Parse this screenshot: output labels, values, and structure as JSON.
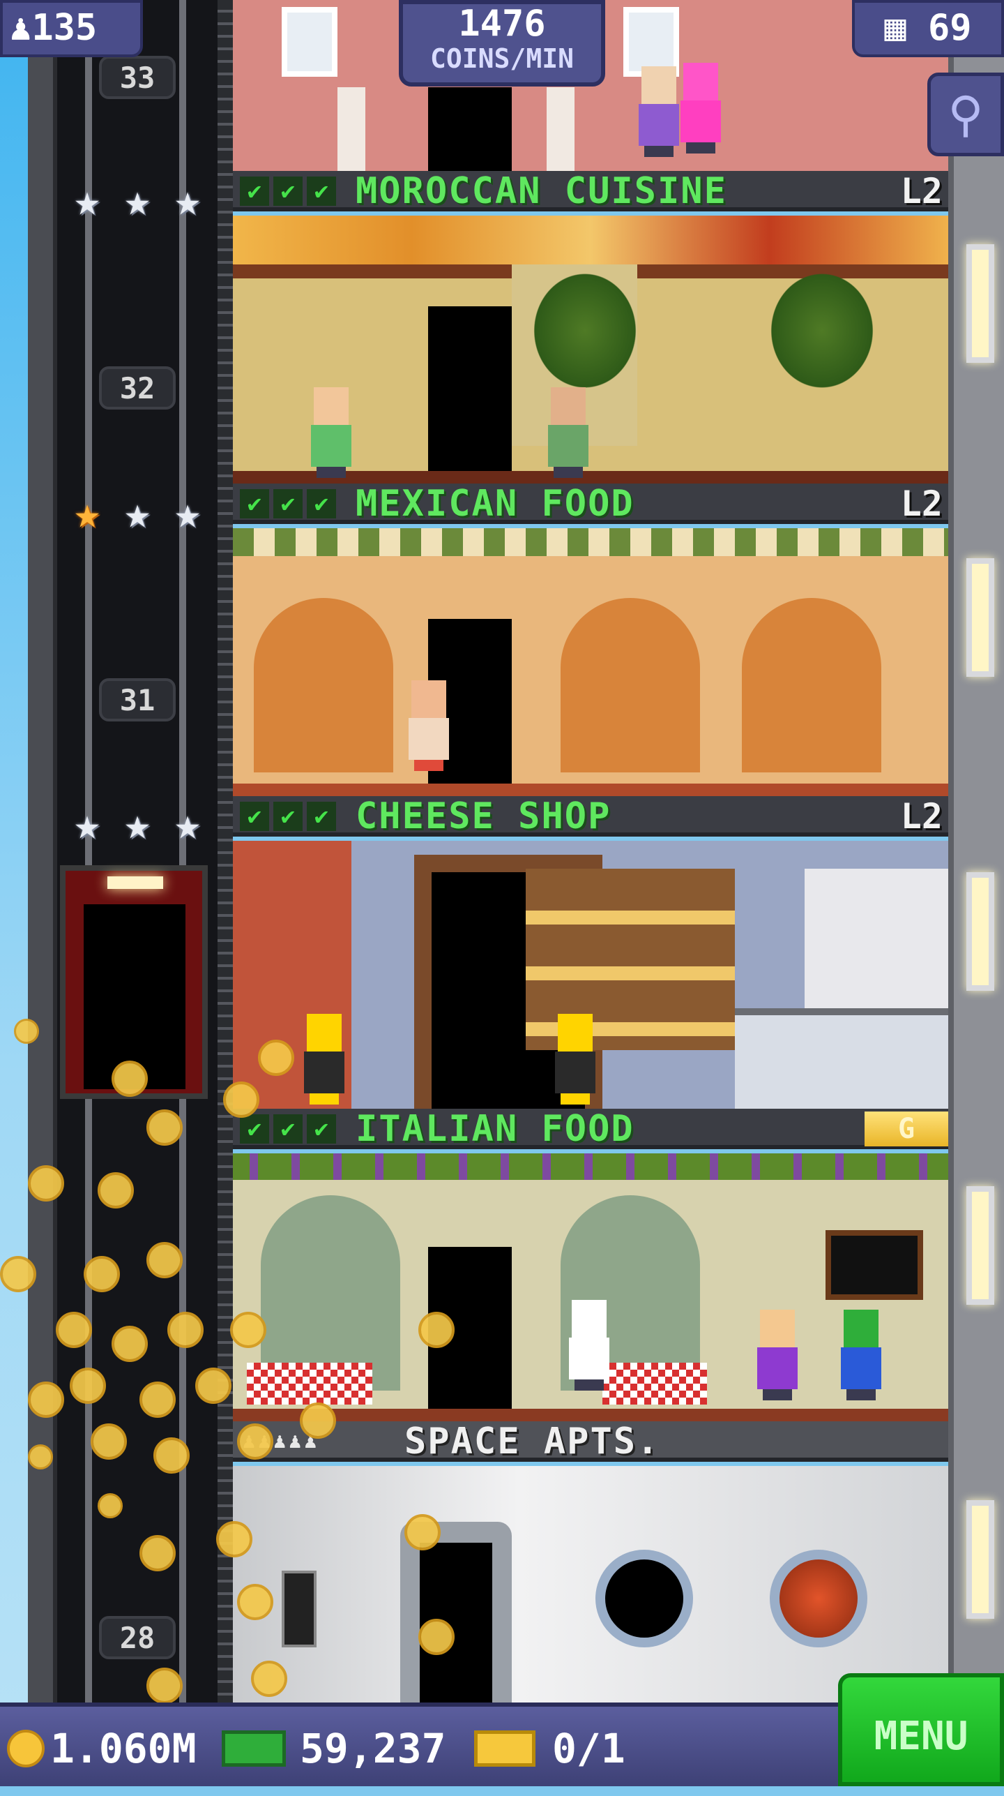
{
  "top_bar": {
    "population": "135",
    "coins_per_min_value": "1476",
    "coins_per_min_unit": "COINS/MIN",
    "floors_count": "69"
  },
  "elevator": {
    "floor_numbers": [
      "33",
      "32",
      "31",
      "28"
    ]
  },
  "floors": [
    {
      "name": "MOROCCAN CUISINE",
      "level": "L2",
      "stars_gold": 0,
      "stars_total": 3
    },
    {
      "name": "MEXICAN FOOD",
      "level": "L2",
      "stars_gold": 1,
      "stars_total": 3
    },
    {
      "name": "CHEESE SHOP",
      "level": "L2"
    },
    {
      "name": "ITALIAN FOOD",
      "badge": "G"
    },
    {
      "name": "SPACE APTS."
    }
  ],
  "bottom_bar": {
    "coins": "1.060M",
    "tower_bux": "59,237",
    "tickets": "0/1",
    "menu_label": "MENU"
  },
  "colors": {
    "header_text": "#5fe85f",
    "menu_button": "#1fc22a",
    "hud": "#4a4d8a"
  }
}
